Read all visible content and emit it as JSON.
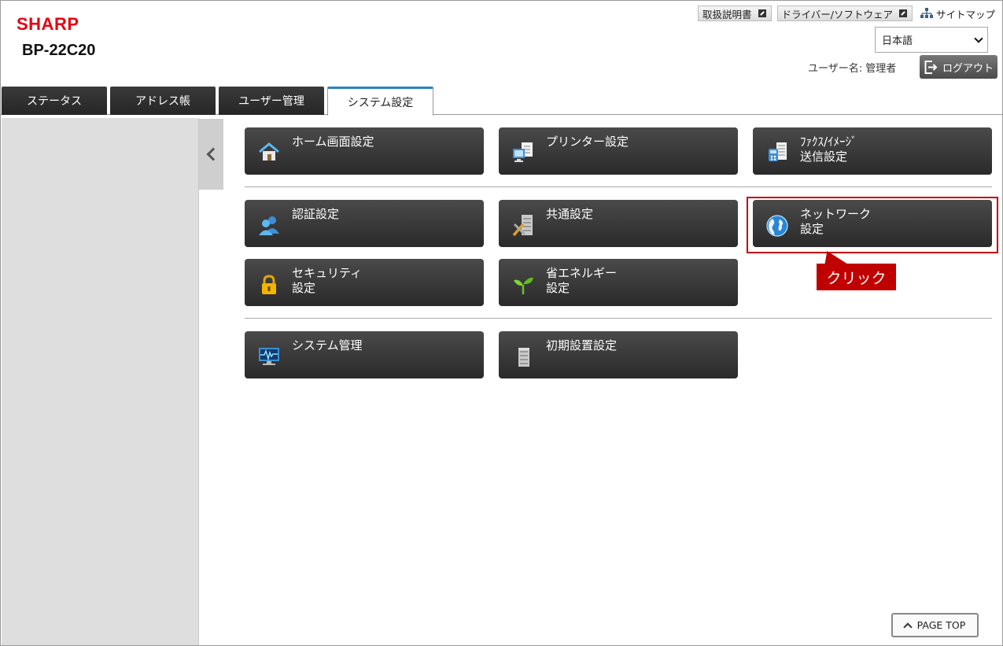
{
  "header": {
    "logo": "SHARP",
    "model": "BP-22C20",
    "manual_link": "取扱説明書",
    "driver_link": "ドライバー/ソフトウェア",
    "sitemap_link": "サイトマップ",
    "language": "日本語",
    "user_label": "ユーザー名: 管理者",
    "logout_label": "ログアウト"
  },
  "tabs": [
    {
      "label": "ステータス"
    },
    {
      "label": "アドレス帳"
    },
    {
      "label": "ユーザー管理"
    },
    {
      "label": "システム設定"
    }
  ],
  "menu": {
    "home_screen": {
      "line1": "ホーム画面設定"
    },
    "printer": {
      "line1": "プリンター設定"
    },
    "fax_image": {
      "line1": "ﾌｧｸｽ/ｲﾒｰｼﾞ",
      "line2": "送信設定"
    },
    "auth": {
      "line1": "認証設定"
    },
    "common": {
      "line1": "共通設定"
    },
    "network": {
      "line1": "ネットワーク",
      "line2": "設定"
    },
    "security": {
      "line1": "セキュリティ",
      "line2": "設定"
    },
    "energy": {
      "line1": "省エネルギー",
      "line2": "設定"
    },
    "system_mgmt": {
      "line1": "システム管理"
    },
    "initial_setup": {
      "line1": "初期設置設定"
    }
  },
  "annotation": {
    "callout": "クリック"
  },
  "footer": {
    "page_top": "PAGE TOP"
  },
  "colors": {
    "brand": "#e60012",
    "tab_active_accent": "#2b83c6",
    "highlight": "#c00000"
  }
}
